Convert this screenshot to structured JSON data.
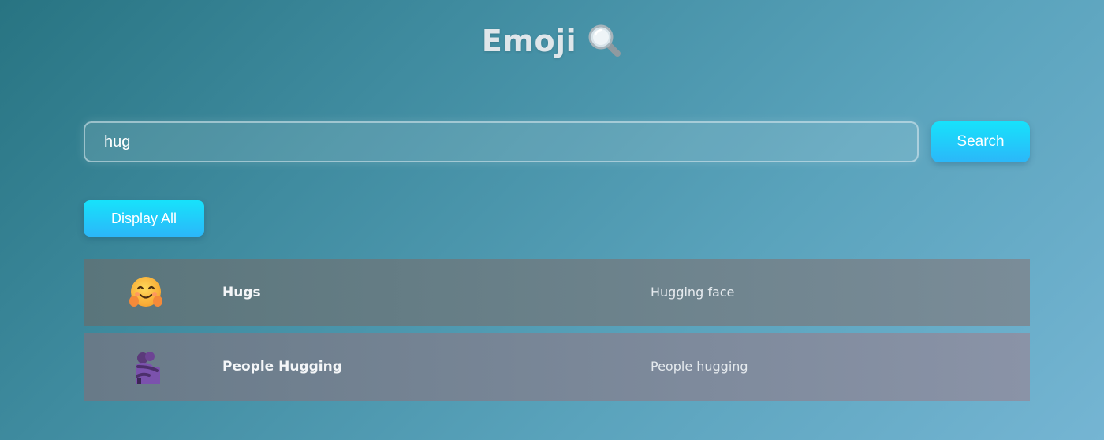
{
  "header": {
    "title": "Emoji",
    "title_icon": "magnifying-glass-icon"
  },
  "search": {
    "value": "hug",
    "placeholder": "",
    "button_label": "Search"
  },
  "controls": {
    "display_all_label": "Display All"
  },
  "results": [
    {
      "icon": "hugging-face-emoji-icon",
      "name": "Hugs",
      "description": "Hugging face"
    },
    {
      "icon": "people-hugging-emoji-icon",
      "name": "People Hugging",
      "description": "People hugging"
    }
  ],
  "colors": {
    "accent_button": "#17e2fb",
    "background_start": "#287482",
    "background_end": "#75b5d3"
  }
}
